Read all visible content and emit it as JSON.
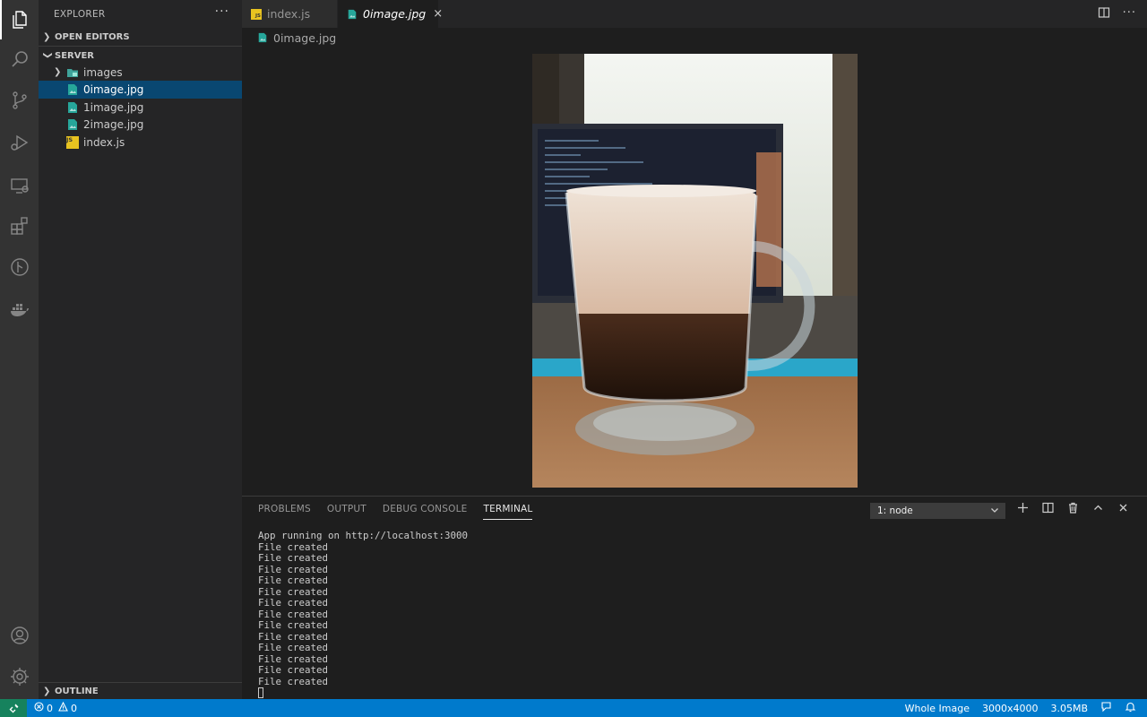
{
  "sidebar": {
    "title": "EXPLORER",
    "more": "···",
    "open_editors": "OPEN EDITORS",
    "root": "SERVER",
    "items": [
      {
        "label": "images",
        "type": "folder"
      },
      {
        "label": "0image.jpg",
        "type": "image",
        "selected": true
      },
      {
        "label": "1image.jpg",
        "type": "image"
      },
      {
        "label": "2image.jpg",
        "type": "image"
      },
      {
        "label": "index.js",
        "type": "js"
      }
    ],
    "outline": "OUTLINE"
  },
  "tabs": [
    {
      "label": "index.js",
      "active": false
    },
    {
      "label": "0image.jpg",
      "active": true,
      "close": "×"
    }
  ],
  "breadcrumb": "0image.jpg",
  "panel": {
    "tabs": [
      "PROBLEMS",
      "OUTPUT",
      "DEBUG CONSOLE",
      "TERMINAL"
    ],
    "active_tab": "TERMINAL",
    "terminal_select": "1: node",
    "terminal_lines": [
      "App running on http://localhost:3000",
      "File created",
      "File created",
      "File created",
      "File created",
      "File created",
      "File created",
      "File created",
      "File created",
      "File created",
      "File created",
      "File created",
      "File created",
      "File created"
    ]
  },
  "statusbar": {
    "errors": "0",
    "warnings": "0",
    "zoom": "Whole Image",
    "dimensions": "3000x4000",
    "size": "3.05MB"
  },
  "colors": {
    "accent": "#007acc",
    "selection": "#094771",
    "remote": "#16825d"
  }
}
